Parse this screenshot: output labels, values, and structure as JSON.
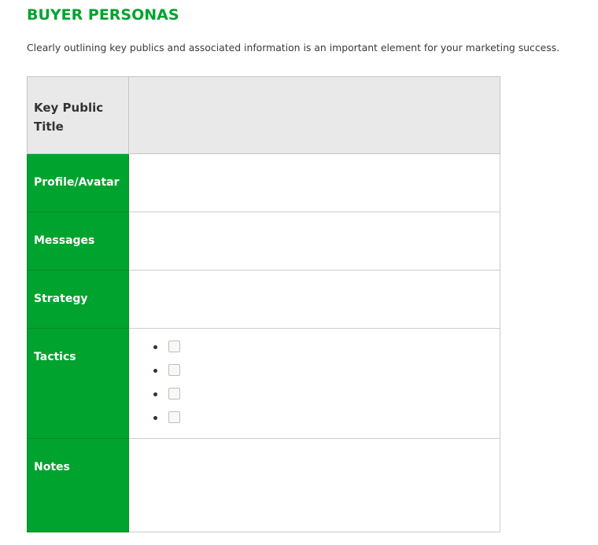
{
  "page": {
    "title": "BUYER PERSONAS",
    "intro": "Clearly outlining key publics and associated information is an important element for your marketing success."
  },
  "colors": {
    "accent_green": "#00a32e",
    "header_gray": "#e9e9e9",
    "border_gray": "#cccccc"
  },
  "table": {
    "header": {
      "label": "Key Public Title",
      "value": ""
    },
    "rows": [
      {
        "label": "Profile/Avatar",
        "value": ""
      },
      {
        "label": "Messages",
        "value": ""
      },
      {
        "label": "Strategy",
        "value": ""
      },
      {
        "label": "Tactics",
        "checkbox_items": [
          {
            "checked": false,
            "text": ""
          },
          {
            "checked": false,
            "text": ""
          },
          {
            "checked": false,
            "text": ""
          },
          {
            "checked": false,
            "text": ""
          }
        ]
      },
      {
        "label": "Notes",
        "value": ""
      }
    ]
  }
}
